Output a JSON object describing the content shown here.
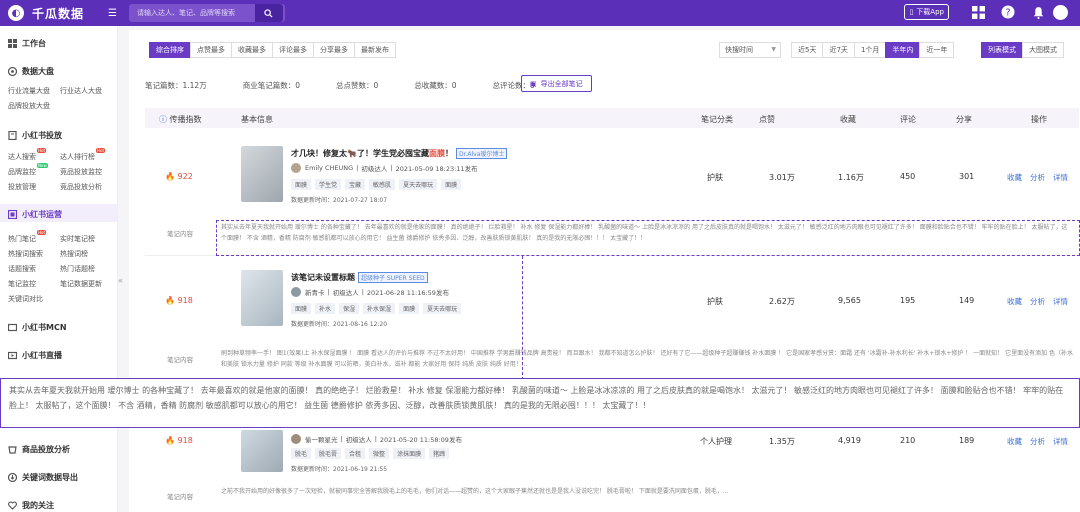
{
  "app": {
    "name": "千瓜数据",
    "search_placeholder": "请输入达人、笔记、品牌等搜索",
    "download_app": "下载App"
  },
  "sidebar": {
    "workbench": "工作台",
    "dashboard": {
      "title": "数据大盘",
      "items": [
        "行业流量大盘",
        "行业达人大盘",
        "品牌投放大盘"
      ]
    },
    "delivery": {
      "title": "小红书投放",
      "items": [
        "达人搜索",
        "达人排行榜",
        "品牌监控",
        "竞品投放监控",
        "投放管理",
        "竞品投放分析"
      ],
      "badges": [
        "Hot",
        "Hot",
        "New"
      ]
    },
    "operation": {
      "title": "小红书运营",
      "items": [
        "热门笔记",
        "实时笔记榜",
        "热搜词搜索",
        "热搜词榜",
        "话题搜索",
        "热门话题榜",
        "笔记监控",
        "笔记数据更新",
        "关键词对比"
      ],
      "badges": [
        "Hot"
      ]
    },
    "mcn": "小红书MCN",
    "live": "小红书直播",
    "goods": "商品投放分析",
    "keyword_export": "关键词数据导出",
    "favorites": "我的关注",
    "collapse": "«"
  },
  "filters": {
    "tabs": [
      "综合排序",
      "点赞最多",
      "收藏最多",
      "评论最多",
      "分享最多",
      "最新发布"
    ],
    "sort_select": "快搜时间",
    "periods": [
      "近5天",
      "近7天",
      "1个月",
      "半年内",
      "近一年"
    ],
    "active_period": "半年内",
    "views": [
      "列表模式",
      "大图模式"
    ]
  },
  "stats": {
    "notes": "笔记篇数：1.12万",
    "commercial": "商业笔记篇数：0",
    "likes": "总点赞数：0",
    "collects": "总收藏数：0",
    "comments": "总评论数：0",
    "export": "导出全部笔记"
  },
  "table": {
    "headers": [
      "传播指数",
      "基本信息",
      "笔记分类",
      "点赞",
      "收藏",
      "评论",
      "分享",
      "操作"
    ],
    "ops": [
      "收藏",
      "分析",
      "详情"
    ],
    "content_label": "笔记内容",
    "rows": [
      {
        "heat": "922",
        "title_parts": [
          "才几块！修复太",
          "了！学生党必囤宝藏",
          "面膜",
          "！"
        ],
        "badge": "Dr.Alva瑷尔博士",
        "author": "Emily CHEUNG",
        "level": "初级达人",
        "published": "2021-05-09 18:23:11发布",
        "tags": [
          "面膜",
          "学生党",
          "宝藏",
          "敏感肌",
          "夏天去哪玩",
          "面膜"
        ],
        "updated": "数据更新时间：2021-07-27 18:07",
        "category": "护肤",
        "likes": "3.01万",
        "collects": "1.16万",
        "comments": "450",
        "shares": "301",
        "content": "其实从去年夏天我就开始用 瑷尔博士 的各种宝藏了！ 去年最喜欢的就是他家的面膜！ 真的绝绝子！ 烂脸救星！ 补水 修复 保湿能力都好棒！ 乳酸菌的味道～ 上脸是冰冰凉凉的 用了之后皮肤真的就是喝饱水！ 太滋元了！ 敏感泛红的地方肉眼也可见褪红了许多！ 面膜和脸贴合也不错！ 牢牢的贴在脸上！ 太服帖了，这个面膜！ 不含 酒精，香精 防腐剂 敏感肌都可以放心的用它！ 益生菌 德爵修护 依秀多因、泛醇，改善肤质锁黄肌肤！ 真的是我的无限必囤！！！ 太宝藏了！！"
      },
      {
        "heat": "918",
        "title": "该笔记未设置标题",
        "badge": "超级种子 SUPER SEED",
        "author": "新青卡",
        "level": "初级达人",
        "published": "2021-06-28 11:16:59发布",
        "tags": [
          "面膜",
          "补水",
          "保湿",
          "补水保湿",
          "面膜",
          "夏天去哪玩"
        ],
        "updated": "数据更新时间：2021-08-16 12:20",
        "category": "护肤",
        "likes": "2.62万",
        "collects": "9,565",
        "comments": "195",
        "shares": "149",
        "content": "刷到种草频率一手！ 图1(效果)上 补水保湿面膜 ！ 面膜 看达人的评价与推荐 不过不太好用！ 中国推荐 学男爵赚钱品牌 高贵能！ 而且跟水！ 我都不知道怎么护肤！ 还好有了它——超级种子超赚赚钱 补水面膜 ！ 它是国家孝感分赏：面霜 还有 '冰霜补-补水利长' 补水+锁水+修护 ！ 一面就知！ 它里面没有添加 色（补水 和美肤 锁水力量 修护 同款 等级 补水面膜 可以防晒，美白补水，滋补 都能 大家好用 保持 纯质 皮肤 纯质 好用！..."
      },
      {
        "heat": "918",
        "author": "偷一颗星光",
        "level": "初级达人",
        "published": "2021-05-20 11:58:09发布",
        "tags": [
          "脱毛",
          "脱毛膏",
          "合租",
          "微整",
          "涂抹面膜",
          "猪蹄"
        ],
        "updated": "数据更新时间：2021-06-19 21:55",
        "category": "个人护理",
        "likes": "1.35万",
        "collects": "4,919",
        "comments": "210",
        "shares": "189",
        "content": "之前不我开始用的好像很多了一次短检，就被同事完全答解我脱毛上的毛毛，他们对话——超赞的，这个大家眼子蕉然还就也是是我人没说吃完！ 脱毛膏啦！ 下面就是要洗同面包蛋，脱毛，..."
      }
    ]
  }
}
